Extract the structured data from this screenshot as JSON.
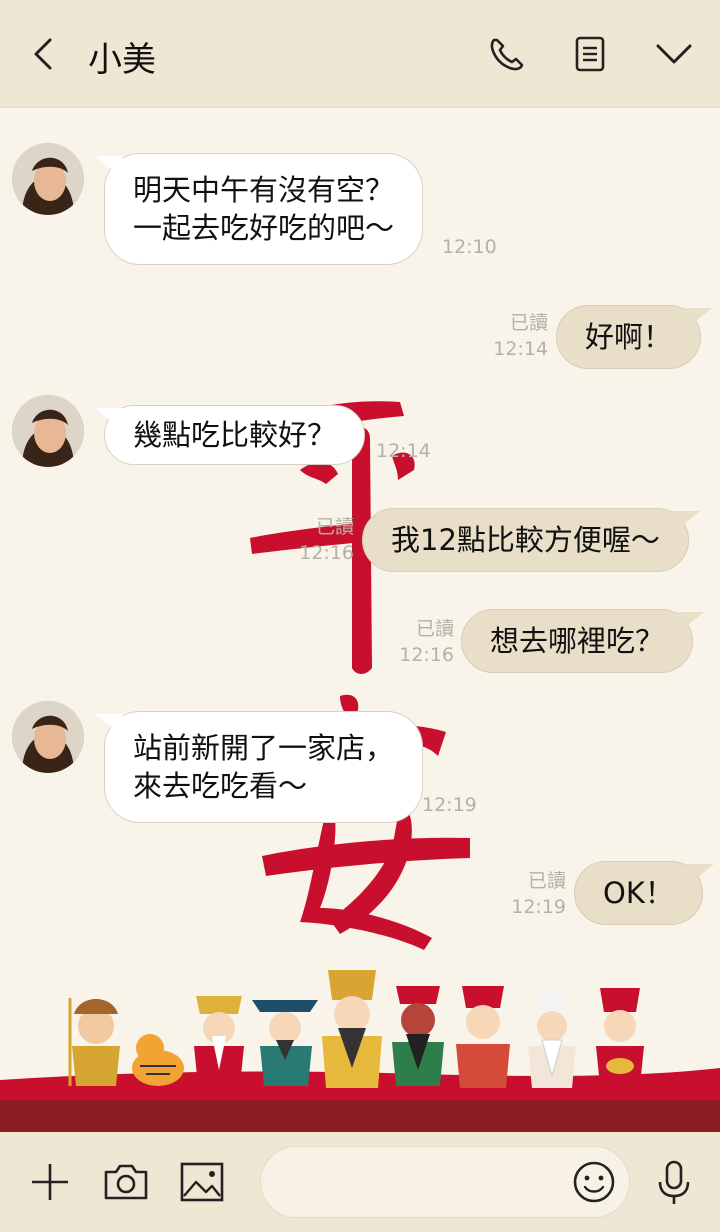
{
  "header": {
    "title": "小美",
    "icons": [
      "back-chevron-icon",
      "phone-icon",
      "notes-icon",
      "chevron-down-icon"
    ]
  },
  "theme": {
    "header_bg": "#f0e6d4",
    "chat_bg": "#f9f4ea",
    "my_bubble": "#e9dfc9",
    "their_bubble": "#ffffff",
    "accent_red": "#c8102e"
  },
  "background_art": {
    "calligraphy": [
      "平",
      "安"
    ]
  },
  "messages": [
    {
      "from": "them",
      "lines": [
        "明天中午有沒有空？",
        "一起去吃好吃的吧～"
      ],
      "time": "12:10"
    },
    {
      "from": "me",
      "lines": [
        "好啊！"
      ],
      "read": "已讀",
      "time": "12:14"
    },
    {
      "from": "them",
      "lines": [
        "幾點吃比較好？"
      ],
      "time": "12:14"
    },
    {
      "from": "me",
      "lines": [
        "我12點比較方便喔～"
      ],
      "read": "已讀",
      "time": "12:16"
    },
    {
      "from": "me",
      "lines": [
        "想去哪裡吃？"
      ],
      "read": "已讀",
      "time": "12:16"
    },
    {
      "from": "them",
      "lines": [
        "站前新開了一家店，",
        "來去吃吃看～"
      ],
      "time": "12:19"
    },
    {
      "from": "me",
      "lines": [
        "OK！"
      ],
      "read": "已讀",
      "time": "12:19"
    }
  ],
  "footer": {
    "icons": [
      "plus-icon",
      "camera-icon",
      "image-icon",
      "emoji-icon",
      "microphone-icon"
    ],
    "input_placeholder": ""
  }
}
